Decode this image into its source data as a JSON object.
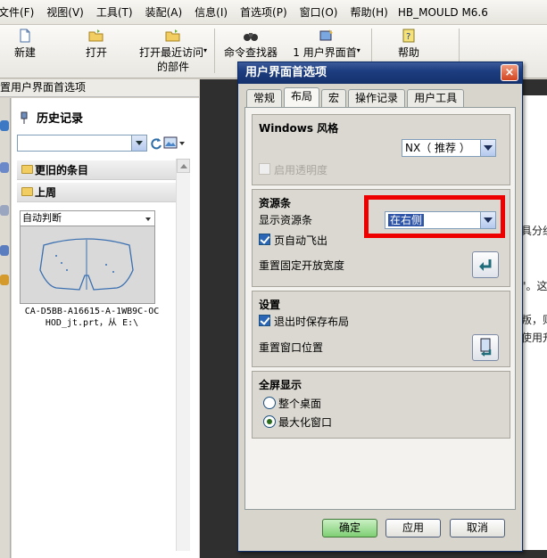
{
  "menubar": {
    "items": [
      "文件(F)",
      "视图(V)",
      "工具(T)",
      "装配(A)",
      "信息(I)",
      "首选项(P)",
      "窗口(O)",
      "帮助(H)"
    ],
    "brand": "HB_MOULD M6.6"
  },
  "toolbar": {
    "new_label": "新建",
    "open_label": "打开",
    "recent_label_1": "打开最近访问",
    "recent_label_2": "的部件",
    "command_finder_label": "命令查找器",
    "ui_pref_label": "1 用户界面首",
    "help_label": "帮助"
  },
  "panel": {
    "header": "置用户界面首选项",
    "title": "历史记录",
    "row_older": "更旧的条目",
    "row_lastweek": "上周",
    "thumb_mode": "自动判断",
    "thumb_caption_1": "CA-D5BB-A16615-A-1WB9C-OC",
    "thumb_caption_2": "HOD_jt.prt，从 E:\\"
  },
  "background": {
    "text_1": "具分组",
    "text_2": "\"。这",
    "text_3": "叛，则",
    "text_4": "使用升"
  },
  "dialog": {
    "title": "用户界面首选项",
    "close_glyph": "×",
    "tabs": [
      "常规",
      "布局",
      "宏",
      "操作记录",
      "用户工具"
    ],
    "active_tab": 1,
    "windows_style": {
      "title": "Windows 风格",
      "style_value": "NX（ 推荐 ）",
      "transparency_label": "启用透明度"
    },
    "resource_bar": {
      "title": "资源条",
      "show_label": "显示资源条",
      "show_value": "在右侧",
      "auto_fly_label": "页自动飞出",
      "reset_width_label": "重置固定开放宽度"
    },
    "settings": {
      "title": "设置",
      "save_layout_label": "退出时保存布局",
      "reset_window_label": "重置窗口位置"
    },
    "fullscreen": {
      "title": "全屏显示",
      "option_desktop": "整个桌面",
      "option_maximize": "最大化窗口",
      "selected": "最大化窗口"
    },
    "buttons": {
      "ok": "确定",
      "apply": "应用",
      "cancel": "取消"
    }
  },
  "colors": {
    "title_bar": "#1c3d80",
    "highlight_box": "#ee0000",
    "ok_button": "#7fcf74"
  }
}
